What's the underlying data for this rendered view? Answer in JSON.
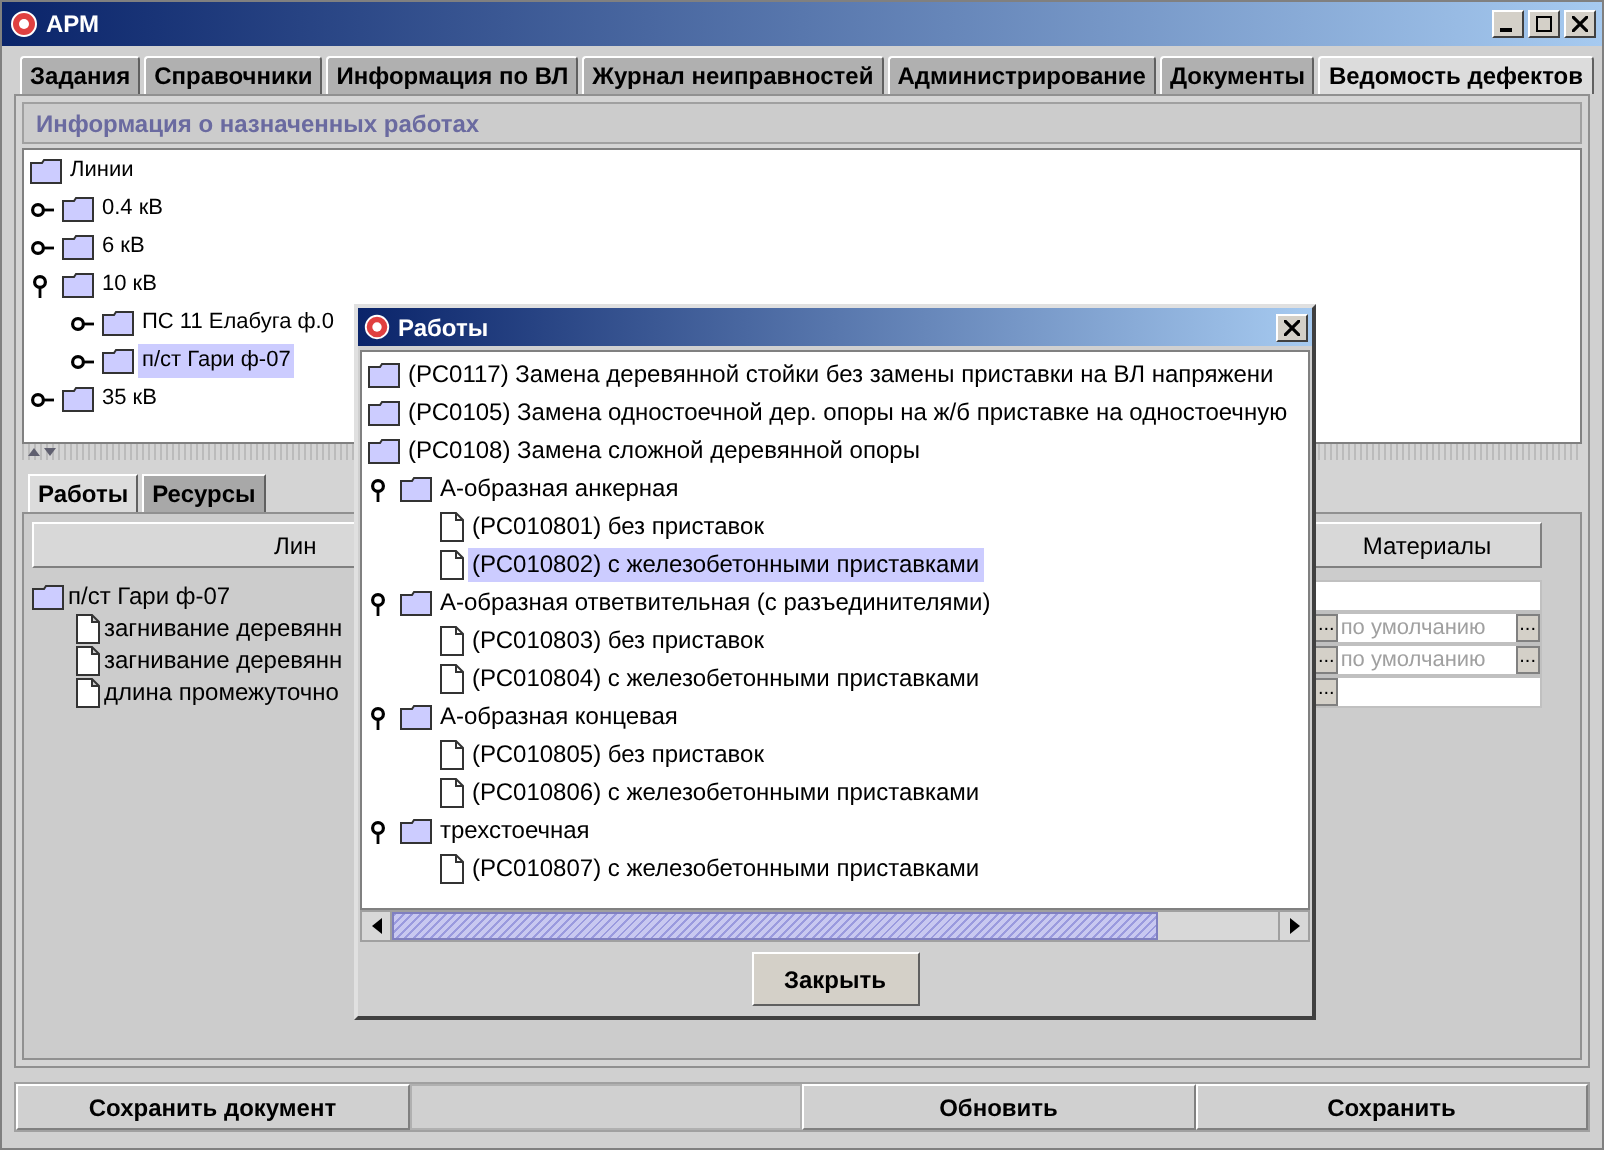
{
  "window": {
    "title": "АРМ"
  },
  "tabs": [
    {
      "label": "Задания",
      "selected": false
    },
    {
      "label": "Справочники",
      "selected": false
    },
    {
      "label": "Информация по ВЛ",
      "selected": false
    },
    {
      "label": "Журнал неиправностей",
      "selected": false
    },
    {
      "label": "Администрирование",
      "selected": false
    },
    {
      "label": "Документы",
      "selected": false
    },
    {
      "label": "Ведомость дефектов",
      "selected": true
    }
  ],
  "assignments_panel": {
    "title": "Информация о назначенных работах",
    "tree": [
      {
        "label": "Линии",
        "kind": "folder",
        "selected": false,
        "children": [
          {
            "label": "0.4 кВ",
            "kind": "folder",
            "expanded": false,
            "selected": false
          },
          {
            "label": "6 кВ",
            "kind": "folder",
            "expanded": false,
            "selected": false
          },
          {
            "label": "10 кВ",
            "kind": "folder",
            "expanded": true,
            "selected": false,
            "children": [
              {
                "label": "ПС 11 Елабуга ф.0",
                "kind": "folder",
                "expanded": false,
                "selected": false
              },
              {
                "label": "п/ст Гари ф-07",
                "kind": "folder",
                "expanded": false,
                "selected": true
              }
            ]
          },
          {
            "label": "35 кВ",
            "kind": "folder",
            "expanded": false,
            "selected": false
          }
        ]
      }
    ]
  },
  "sub_tabs": [
    {
      "label": "Работы",
      "selected": true
    },
    {
      "label": "Ресурсы",
      "selected": false
    }
  ],
  "table": {
    "columns": [
      "Лин",
      "Материалы"
    ],
    "rows": [
      {
        "kind": "folder",
        "label": "п/ст Гари ф-07"
      },
      {
        "kind": "leaf",
        "label": "загнивание деревянн",
        "pick_button": "...",
        "material": "по умолчанию",
        "material_button": "..."
      },
      {
        "kind": "leaf",
        "label": "загнивание деревянн",
        "pick_button": "...",
        "material": "по умолчанию",
        "material_button": "..."
      },
      {
        "kind": "leaf",
        "label": "длина промежуточно",
        "pick_button": "..."
      }
    ]
  },
  "dialog": {
    "title": "Работы",
    "close_button": "Закрыть",
    "tree": [
      {
        "label": "(РС0117) Замена деревянной стойки без замены приставки на ВЛ напряжени",
        "kind": "folder",
        "selected": false
      },
      {
        "label": "(РС0105) Замена одностоечной дер. опоры на ж/б приставке на одностоечную",
        "kind": "folder",
        "selected": false
      },
      {
        "label": "(РС0108) Замена сложной деревянной опоры",
        "kind": "folder",
        "selected": false,
        "children": [
          {
            "label": "А-образная анкерная",
            "kind": "folder",
            "expanded": true,
            "selected": false,
            "children": [
              {
                "label": "(РС010801) без приставок",
                "kind": "leaf",
                "selected": false
              },
              {
                "label": "(РС010802) с железобетонными приставками",
                "kind": "leaf",
                "selected": true
              }
            ]
          },
          {
            "label": "А-образная ответвительная (с разъединителями)",
            "kind": "folder",
            "expanded": true,
            "selected": false,
            "children": [
              {
                "label": "(РС010803) без приставок",
                "kind": "leaf",
                "selected": false
              },
              {
                "label": "(РС010804) с железобетонными приставками",
                "kind": "leaf",
                "selected": false
              }
            ]
          },
          {
            "label": "А-образная концевая",
            "kind": "folder",
            "expanded": true,
            "selected": false,
            "children": [
              {
                "label": "(РС010805) без приставок",
                "kind": "leaf",
                "selected": false
              },
              {
                "label": "(РС010806) с железобетонными приставками",
                "kind": "leaf",
                "selected": false
              }
            ]
          },
          {
            "label": "трехстоечная",
            "kind": "folder",
            "expanded": true,
            "selected": false,
            "children": [
              {
                "label": "(РС010807) с железобетонными приставками",
                "kind": "leaf",
                "selected": false
              }
            ]
          }
        ]
      }
    ]
  },
  "bottom_bar": {
    "left": [
      "Сохранить документ"
    ],
    "right": [
      "Обновить",
      "Сохранить"
    ]
  }
}
